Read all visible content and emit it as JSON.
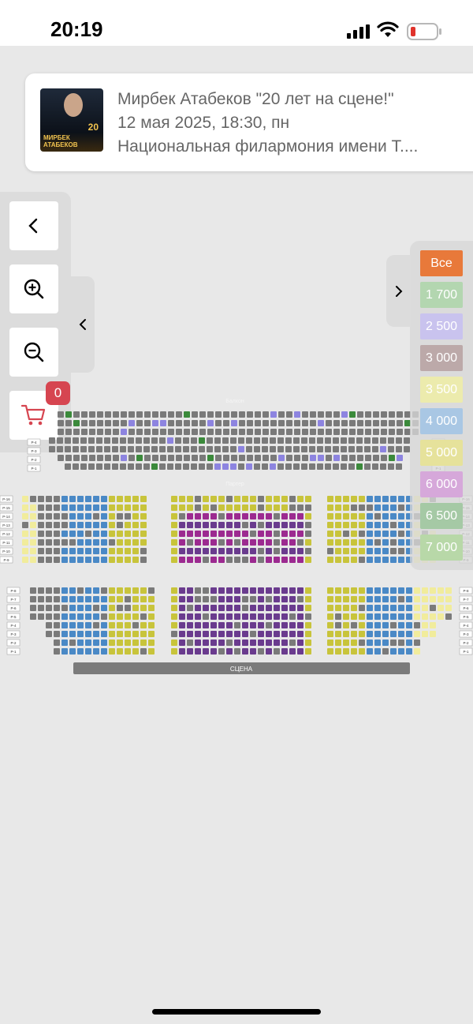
{
  "status": {
    "time": "20:19"
  },
  "event": {
    "title": "Мирбек Атабеков \"20 лет на сцене!\"",
    "date": "12 мая 2025, 18:30, пн",
    "venue": "Национальная филармония имени Т....",
    "poster_name": "МИРБЕК АТАБЕКОВ",
    "poster_badge": "20"
  },
  "cart": {
    "count": "0"
  },
  "sections": {
    "balcony": "Балкон",
    "parterre": "Партер",
    "stage": "СЦЕНА"
  },
  "price_filter": [
    {
      "label": "Все",
      "bg": "#e8793a",
      "fg": "#ffffff"
    },
    {
      "label": "1 700",
      "bg": "#b3d6b0",
      "fg": "#ffffff"
    },
    {
      "label": "2 500",
      "bg": "#c9c3ee",
      "fg": "#ffffff"
    },
    {
      "label": "3 000",
      "bg": "#bca9a9",
      "fg": "#ffffff"
    },
    {
      "label": "3 500",
      "bg": "#ecebad",
      "fg": "#ffffff"
    },
    {
      "label": "4 000",
      "bg": "#a9c7e4",
      "fg": "#ffffff"
    },
    {
      "label": "5 000",
      "bg": "#e6e29b",
      "fg": "#ffffff"
    },
    {
      "label": "6 000",
      "bg": "#d6a8da",
      "fg": "#ffffff"
    },
    {
      "label": "6 500",
      "bg": "#a5c9a5",
      "fg": "#ffffff"
    },
    {
      "label": "7 000",
      "bg": "#b8d8a8",
      "fg": "#ffffff"
    }
  ],
  "balcony_row_labels": [
    "Р-4",
    "Р-3",
    "Р-2",
    "Р-1"
  ],
  "parterre_top_row_labels": [
    "Р-16",
    "Р-15",
    "Р-14",
    "Р-13",
    "Р-12",
    "Р-11",
    "Р-10",
    "Р-9"
  ],
  "parterre_bottom_row_labels": [
    "Р-8",
    "Р-7",
    "Р-6",
    "Р-5",
    "Р-4",
    "Р-3",
    "Р-2",
    "Р-1"
  ],
  "seat_colors": {
    "occupied": "#7a7a7a",
    "blue": "#4a89c6",
    "yellow": "#c8c43b",
    "purple": "#6a3b8e",
    "magenta": "#9c2a90",
    "green": "#3b8a3b",
    "lavender": "#8d84e0",
    "pale": "#f1ec9c"
  }
}
